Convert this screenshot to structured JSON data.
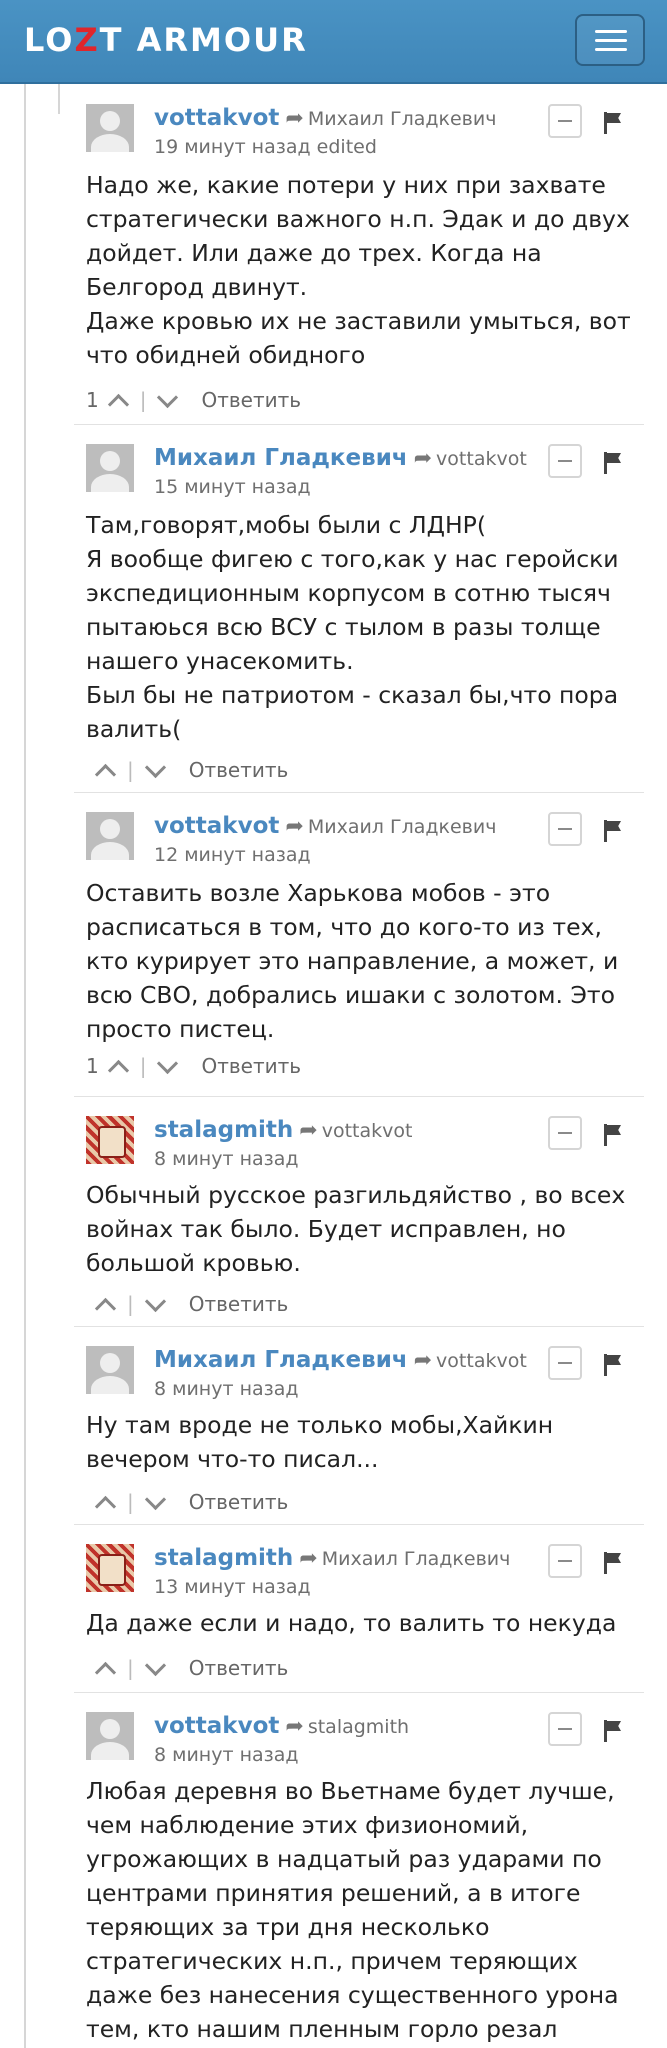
{
  "header": {
    "logo_part1": "LO",
    "logo_accent": "Z",
    "logo_part2": "T ARMOUR",
    "menu_icon": "hamburger-icon",
    "background_color": "#4a93c4",
    "accent_color": "#e0262b"
  },
  "comments": [
    {
      "author": "vottakvot",
      "reply_to": "Михаил Гладкевич",
      "time": "19 минут назад edited",
      "avatar": "default-avatar",
      "paragraphs": [
        "Надо же, какие потери у них при захвате стратегически важного н.п. Эдак и до двух дойдет. Или даже до трех. Когда на Белгород двинут.",
        "Даже кровью их не заставили умыться, вот что обидней обидного"
      ],
      "votes": "1",
      "reply_label": "Ответить"
    },
    {
      "author": "Михаил Гладкевич",
      "reply_to": "vottakvot",
      "time": "15 минут назад",
      "avatar": "default-avatar",
      "paragraphs": [
        "Там,говорят,мобы были с ЛДНР(",
        "Я вообще фигею с того,как у нас геройски экспедиционным корпусом в сотню тысяч пытаюься всю ВСУ с тылом в разы толще нашего унасекомить.",
        "Был бы не патриотом - сказал бы,что пора валить("
      ],
      "votes": "",
      "reply_label": "Ответить"
    },
    {
      "author": "vottakvot",
      "reply_to": "Михаил Гладкевич",
      "time": "12 минут назад",
      "avatar": "default-avatar",
      "paragraphs": [
        "Оставить возле Харькова мобов - это расписаться в том, что до кого-то из тех, кто курирует это направление, а может, и всю СВО, добрались ишаки с золотом. Это просто пистец."
      ],
      "votes": "1",
      "reply_label": "Ответить"
    },
    {
      "author": "stalagmith",
      "reply_to": "vottakvot",
      "time": "8 минут назад",
      "avatar": "art-avatar",
      "paragraphs": [
        "Обычный русское разгильдяйство , во всех войнах так было. Будет исправлен, но большой кровью."
      ],
      "votes": "",
      "reply_label": "Ответить"
    },
    {
      "author": "Михаил Гладкевич",
      "reply_to": "vottakvot",
      "time": "8 минут назад",
      "avatar": "default-avatar",
      "paragraphs": [
        "Ну там вроде не только мобы,Хайкин вечером что-то писал..."
      ],
      "votes": "",
      "reply_label": "Ответить"
    },
    {
      "author": "stalagmith",
      "reply_to": "Михаил Гладкевич",
      "time": "13 минут назад",
      "avatar": "art-avatar",
      "paragraphs": [
        "Да даже если и надо, то валить то некуда"
      ],
      "votes": "",
      "reply_label": "Ответить"
    },
    {
      "author": "vottakvot",
      "reply_to": "stalagmith",
      "time": "8 минут назад",
      "avatar": "default-avatar",
      "paragraphs": [
        "Любая деревня во Вьетнаме будет лучше, чем наблюдение этих физиономий, угрожающих в надцатый раз ударами по центрами принятия решений, а в итоге теряющих за три дня несколько стратегических н.п., причем теряющих даже без нанесения существенного урона тем, кто нашим пленным горло резал"
      ],
      "votes": "",
      "reply_label": "Ответить"
    }
  ]
}
